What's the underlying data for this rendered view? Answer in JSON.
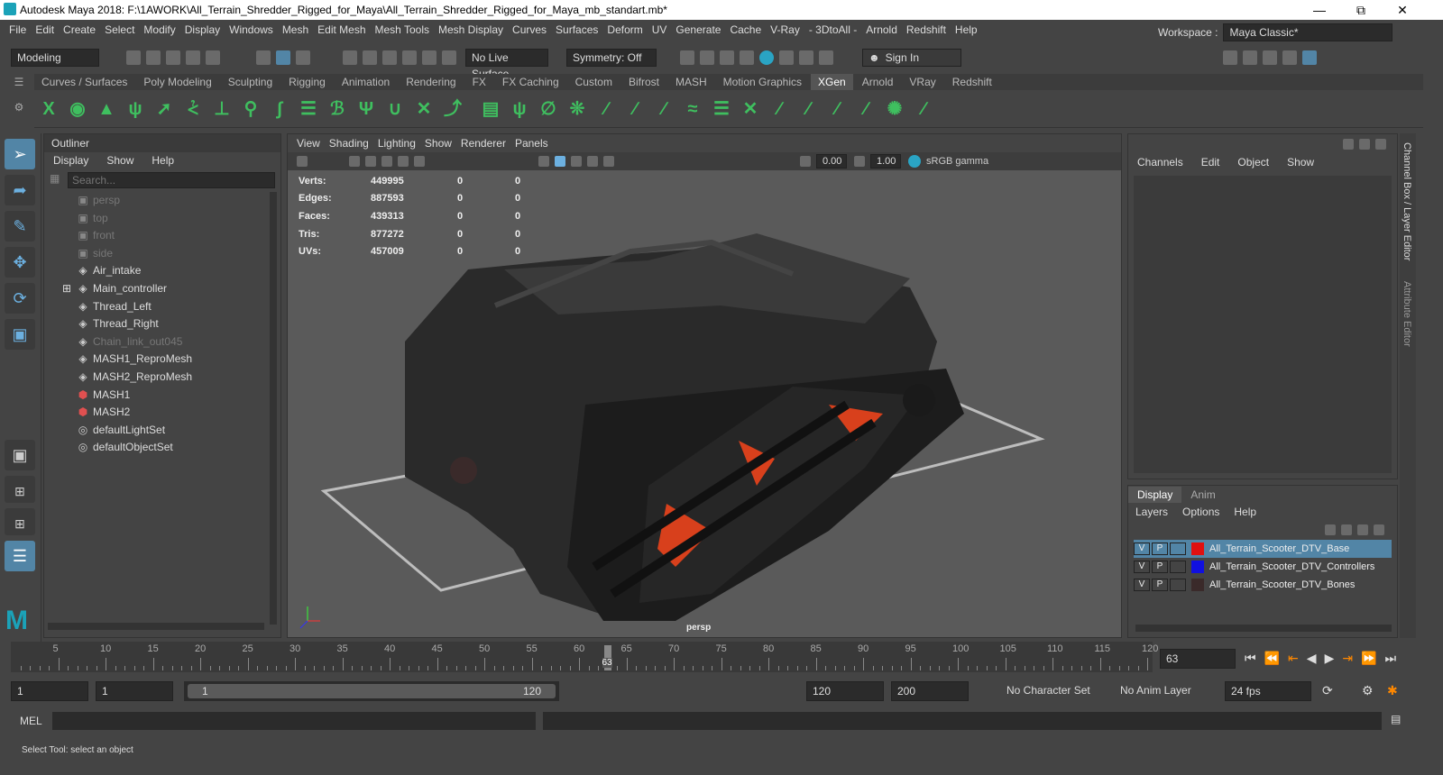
{
  "window": {
    "title": "Autodesk Maya 2018: F:\\1AWORK\\All_Terrain_Shredder_Rigged_for_Maya\\All_Terrain_Shredder_Rigged_for_Maya_mb_standart.mb*"
  },
  "menu": [
    "File",
    "Edit",
    "Create",
    "Select",
    "Modify",
    "Display",
    "Windows",
    "Mesh",
    "Edit Mesh",
    "Mesh Tools",
    "Mesh Display",
    "Curves",
    "Surfaces",
    "Deform",
    "UV",
    "Generate",
    "Cache",
    "V-Ray",
    "- 3DtoAll -",
    "Arnold",
    "Redshift",
    "Help"
  ],
  "workspace": {
    "label": "Workspace :",
    "value": "Maya Classic*"
  },
  "status": {
    "mode": "Modeling",
    "live_surface": "No Live Surface",
    "symmetry": "Symmetry: Off",
    "sign_in": "Sign In"
  },
  "shelf_tabs": [
    "Curves / Surfaces",
    "Poly Modeling",
    "Sculpting",
    "Rigging",
    "Animation",
    "Rendering",
    "FX",
    "FX Caching",
    "Custom",
    "Bifrost",
    "MASH",
    "Motion Graphics",
    "XGen",
    "Arnold",
    "VRay",
    "Redshift"
  ],
  "shelf_active": "XGen",
  "outliner": {
    "title": "Outliner",
    "menu": [
      "Display",
      "Show",
      "Help"
    ],
    "search_placeholder": "Search...",
    "items": [
      {
        "label": "persp",
        "icon": "camera-icon",
        "dim": true
      },
      {
        "label": "top",
        "icon": "camera-icon",
        "dim": true
      },
      {
        "label": "front",
        "icon": "camera-icon",
        "dim": true
      },
      {
        "label": "side",
        "icon": "camera-icon",
        "dim": true
      },
      {
        "label": "Air_intake",
        "icon": "transform-icon",
        "dim": false
      },
      {
        "label": "Main_controller",
        "icon": "transform-icon",
        "dim": false,
        "expand": true
      },
      {
        "label": "Thread_Left",
        "icon": "transform-icon",
        "dim": false
      },
      {
        "label": "Thread_Right",
        "icon": "transform-icon",
        "dim": false
      },
      {
        "label": "Chain_link_out045",
        "icon": "transform-icon",
        "dim": true
      },
      {
        "label": "MASH1_ReproMesh",
        "icon": "transform-icon",
        "dim": false
      },
      {
        "label": "MASH2_ReproMesh",
        "icon": "transform-icon",
        "dim": false
      },
      {
        "label": "MASH1",
        "icon": "mash-icon",
        "dim": false
      },
      {
        "label": "MASH2",
        "icon": "mash-icon",
        "dim": false
      },
      {
        "label": "defaultLightSet",
        "icon": "set-icon",
        "dim": false
      },
      {
        "label": "defaultObjectSet",
        "icon": "set-icon",
        "dim": false
      }
    ]
  },
  "viewport": {
    "menu": [
      "View",
      "Shading",
      "Lighting",
      "Show",
      "Renderer",
      "Panels"
    ],
    "exposure": "0.00",
    "gamma": "1.00",
    "color_space": "sRGB gamma",
    "camera": "persp",
    "hud": [
      {
        "k": "Verts:",
        "v": "449995",
        "a": "0",
        "b": "0"
      },
      {
        "k": "Edges:",
        "v": "887593",
        "a": "0",
        "b": "0"
      },
      {
        "k": "Faces:",
        "v": "439313",
        "a": "0",
        "b": "0"
      },
      {
        "k": "Tris:",
        "v": "877272",
        "a": "0",
        "b": "0"
      },
      {
        "k": "UVs:",
        "v": "457009",
        "a": "0",
        "b": "0"
      }
    ]
  },
  "channelbox": {
    "menu": [
      "Channels",
      "Edit",
      "Object",
      "Show"
    ],
    "side_tabs": [
      "Channel Box / Layer Editor",
      "Attribute Editor"
    ]
  },
  "layers": {
    "tabs": [
      "Display",
      "Anim"
    ],
    "menu": [
      "Layers",
      "Options",
      "Help"
    ],
    "rows": [
      {
        "v": "V",
        "p": "P",
        "color": "#e01010",
        "name": "All_Terrain_Scooter_DTV_Base",
        "selected": true
      },
      {
        "v": "V",
        "p": "P",
        "color": "#1010e0",
        "name": "All_Terrain_Scooter_DTV_Controllers",
        "selected": false
      },
      {
        "v": "V",
        "p": "P",
        "color": "#3a2a2a",
        "name": "All_Terrain_Scooter_DTV_Bones",
        "selected": false
      }
    ]
  },
  "timeline": {
    "ticks": [
      "5",
      "10",
      "15",
      "20",
      "25",
      "30",
      "35",
      "40",
      "45",
      "50",
      "55",
      "60",
      "65",
      "70",
      "75",
      "80",
      "85",
      "90",
      "95",
      "100",
      "105",
      "110",
      "115",
      "120"
    ],
    "current": "63",
    "current_field": "63"
  },
  "range": {
    "start": "1",
    "inner_start": "1",
    "slider_start": "1",
    "slider_end": "120",
    "end": "120",
    "anim_end": "200",
    "character_set": "No Character Set",
    "anim_layer": "No Anim Layer",
    "fps": "24 fps"
  },
  "cmd": {
    "label": "MEL"
  },
  "help": {
    "text": "Select Tool: select an object"
  }
}
